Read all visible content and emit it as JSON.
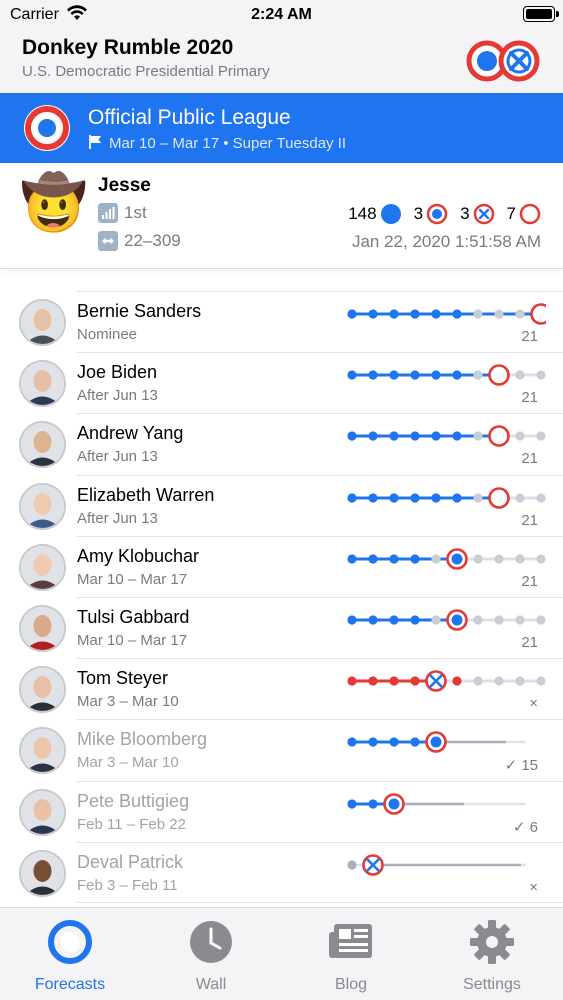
{
  "status": {
    "carrier": "Carrier",
    "time": "2:24 AM"
  },
  "app": {
    "title": "Donkey Rumble 2020",
    "subtitle": "U.S. Democratic Presidential Primary"
  },
  "league": {
    "title": "Official Public League",
    "dates": "Mar 10 – Mar 17 • Super Tuesday II"
  },
  "user": {
    "name": "Jesse",
    "emoji": "🤠",
    "rank": "1st",
    "range": "22–309",
    "stats": [
      {
        "value": "148",
        "icon": "filled-dot-icon"
      },
      {
        "value": "3",
        "icon": "ring-dot-icon"
      },
      {
        "value": "3",
        "icon": "ring-x-icon"
      },
      {
        "value": "7",
        "icon": "empty-ring-icon"
      }
    ],
    "date": "Jan 22, 2020 1:51:58 AM"
  },
  "candidates": [
    {
      "name": "Bernie Sanders",
      "date": "Nominee",
      "score": "21",
      "faded": false,
      "skin": "#e8c1a5",
      "hair": "#d9d9d9",
      "suit": "#4a4f5a"
    },
    {
      "name": "Joe Biden",
      "date": "After Jun 13",
      "score": "21",
      "faded": false,
      "skin": "#e7bea3",
      "hair": "#f0f0f0",
      "suit": "#2d3a55"
    },
    {
      "name": "Andrew Yang",
      "date": "After Jun 13",
      "score": "21",
      "faded": false,
      "skin": "#dcb48f",
      "hair": "#1e1e1e",
      "suit": "#2c3340"
    },
    {
      "name": "Elizabeth Warren",
      "date": "After Jun 13",
      "score": "21",
      "faded": false,
      "skin": "#efc9b0",
      "hair": "#c8b49a",
      "suit": "#3c5a8a"
    },
    {
      "name": "Amy Klobuchar",
      "date": "Mar 10 – Mar 17",
      "score": "21",
      "faded": false,
      "skin": "#efcbb2",
      "hair": "#b48c5a",
      "suit": "#5a3e3e"
    },
    {
      "name": "Tulsi Gabbard",
      "date": "Mar 10 – Mar 17",
      "score": "21",
      "faded": false,
      "skin": "#d9a98a",
      "hair": "#3a2418",
      "suit": "#b02020"
    },
    {
      "name": "Tom Steyer",
      "date": "Mar 3 – Mar 10",
      "score": "×",
      "faded": false,
      "skin": "#e9c0a6",
      "hair": "#cfcfcf",
      "suit": "#2b2f38"
    },
    {
      "name": "Mike Bloomberg",
      "date": "Mar 3 – Mar 10",
      "score": "✓ 15",
      "faded": true,
      "skin": "#ecc6ad",
      "hair": "#bdbdbd",
      "suit": "#2c3444"
    },
    {
      "name": "Pete Buttigieg",
      "date": "Feb 11 – Feb 22",
      "score": "✓ 6",
      "faded": true,
      "skin": "#e9c2a6",
      "hair": "#3b2a20",
      "suit": "#2a3650"
    },
    {
      "name": "Deval Patrick",
      "date": "Feb 3 – Feb 11",
      "score": "×",
      "faded": true,
      "skin": "#7a4e36",
      "hair": "#3a3a3a",
      "suit": "#2b2f38"
    }
  ],
  "tabs": [
    {
      "label": "Forecasts",
      "icon": "target-icon",
      "active": true
    },
    {
      "label": "Wall",
      "icon": "clock-icon",
      "active": false
    },
    {
      "label": "Blog",
      "icon": "newspaper-icon",
      "active": false
    },
    {
      "label": "Settings",
      "icon": "gear-icon",
      "active": false
    }
  ],
  "colors": {
    "accent": "#1f74f0",
    "red": "#e53935",
    "grey": "#c9cdd4"
  }
}
